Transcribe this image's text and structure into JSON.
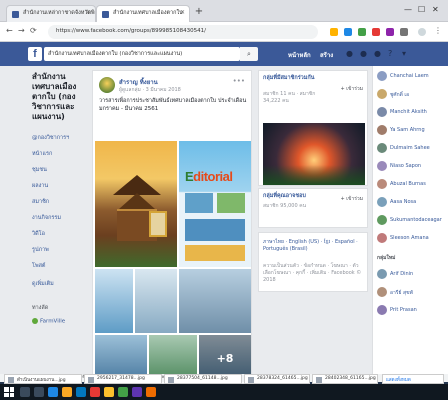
{
  "browser": {
    "tabs": [
      {
        "label": "สำนักงานเหล่ากาชาดจังหวัดพิ"
      },
      {
        "label": "สำนักงานเทศบาลเมืองตากใบ"
      }
    ],
    "url": "https://www.facebook.com/groups/899985108430541/",
    "status_url": "https://www.facebook.com/photo.php?fbid=-4391638883838...&set=pcb.22258474152784...",
    "downloads": [
      {
        "name": "ดำเนินงานแผนงาน...jpg"
      },
      {
        "name": "2956217_31478...jpg"
      },
      {
        "name": "28377504_61148...jpg"
      },
      {
        "name": "28378324_61465...jpg"
      },
      {
        "name": "28402348_61165...jpg"
      }
    ],
    "show_all": "แสดงทั้งหมด"
  },
  "facebook": {
    "search_value": "สำนักงานเทศบาลเมืองตากใบ (กองวิชาการและแผนงาน)",
    "header_right": [
      "หน้าหลัก",
      "สร้าง"
    ],
    "page_name": "สำนักงานเทศบาลเมืองตากใบ (กองวิชาการและแผนงาน)",
    "page_handle": "@กองวิชาการฯ",
    "left_nav": [
      "หน้าแรก",
      "ชุมชน",
      "ผลงาน",
      "สมาชิก",
      "งานกิจกรรม",
      "วิดีโอ",
      "รูปภาพ",
      "โพสต์",
      "ดูเพิ่มเติม"
    ],
    "left_extra": "ทางลัด",
    "farmville": "FarmVille",
    "post": {
      "author": "สำราญ ทิ้งยาน",
      "meta": "ผู้ดูแลกลุ่ม · 3 มีนาคม 2018",
      "text": "วารสารเพื่อการประชาสัมพันธ์เทศบาลเมืองตากใบ ประจำเดือน มกราคม - มีนาคม 2561",
      "editorial_word": "ditorial",
      "editorial_first": "E",
      "more_photos": "+8"
    },
    "right": {
      "card1_title": "กลุ่มที่มีสมาชิกร่วมกัน",
      "card1_sub": "สมาชิก 11 คน · สมาชิก 34,222 คน",
      "card1_btn": "+ เข้าร่วม",
      "card2_title": "กลุ่มที่คุณอาจชอบ",
      "card2_sub": "สมาชิก 95,000 คน",
      "card2_btn": "+ เข้าร่วม",
      "lang_text": "ภาษาไทย · English (US) · ខ្មែរ · Español · Português (Brasil)",
      "footer": "ความเป็นส่วนตัว · ข้อกำหนด · โฆษณา · ตัวเลือกโฆษณา · คุกกี้ · เพิ่มเติม · Facebook © 2018"
    },
    "chat": {
      "contacts": [
        "Chanchai Laem",
        "ชูศักดิ์ เอ",
        "Manchit Aksith",
        "Ya Sam Ahrng",
        "Dulmaim Sahee",
        "Niaso Sapon",
        "Abuzal Burnas",
        "Aasa Nosa",
        "Sukumantodaceagar",
        "Sleeson Amana"
      ],
      "section": "กลุ่มใหม่",
      "contacts2": [
        "Arif Dinin",
        "อารีย์ สุขพั",
        "Prit Prasan"
      ]
    }
  }
}
